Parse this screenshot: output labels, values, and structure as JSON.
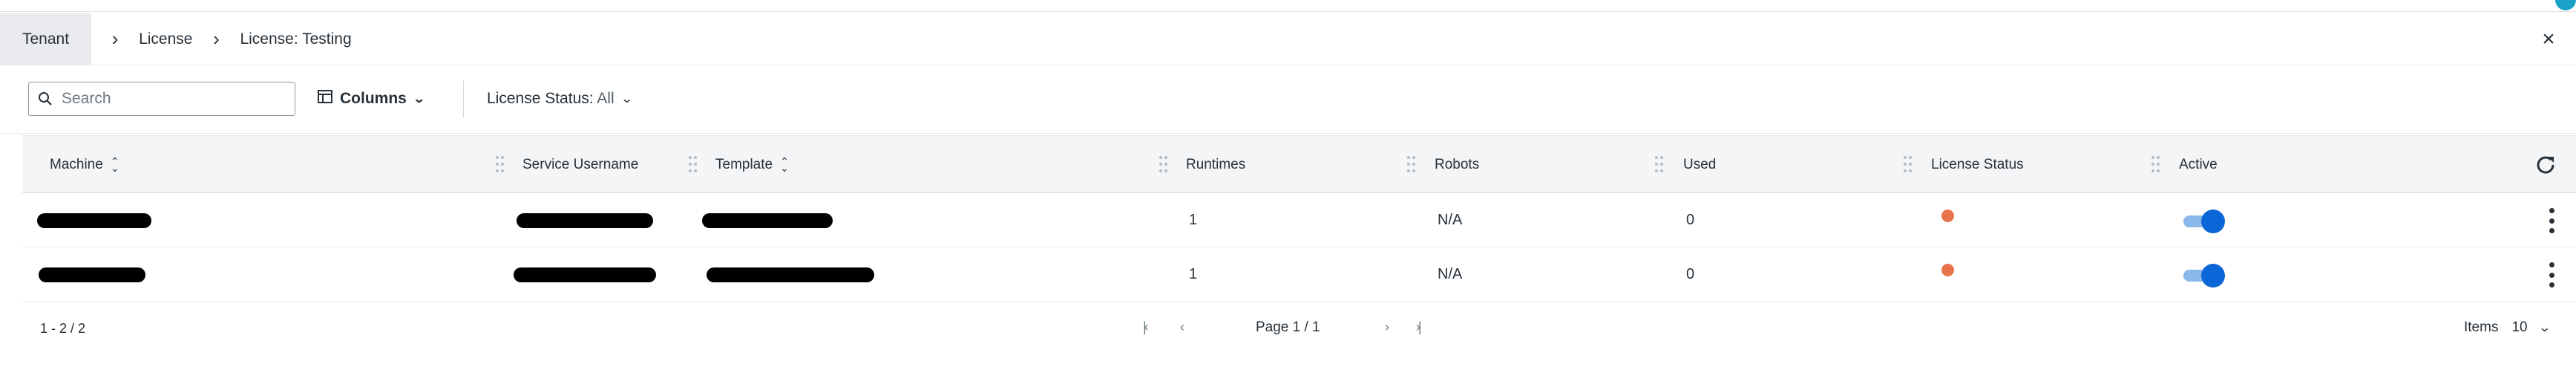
{
  "breadcrumb": {
    "items": [
      "Tenant",
      "License",
      "License: Testing"
    ],
    "separator": "›"
  },
  "toolbar": {
    "search_placeholder": "Search",
    "columns_label": "Columns",
    "status_filter_label": "License Status:",
    "status_filter_value": "All"
  },
  "table": {
    "columns": [
      "Machine",
      "Service Username",
      "Template",
      "Runtimes",
      "Robots",
      "Used",
      "License Status",
      "Active"
    ],
    "rows": [
      {
        "machine": "[redacted]",
        "service_username": "[redacted]",
        "template": "[redacted]",
        "runtimes": "1",
        "robots": "N/A",
        "used": "0",
        "license_status_color": "#e9744c",
        "active": true
      },
      {
        "machine": "[redacted]",
        "service_username": "[redacted]",
        "template": "[redacted]",
        "runtimes": "1",
        "robots": "N/A",
        "used": "0",
        "license_status_color": "#e9744c",
        "active": true
      }
    ]
  },
  "footer": {
    "range": "1 - 2 / 2",
    "page_label": "Page 1 / 1",
    "items_label": "Items",
    "items_value": "10"
  },
  "icons": {
    "close": "close-icon",
    "search": "search-icon",
    "columns": "columns-icon",
    "refresh": "refresh-icon",
    "sort": "sort-icon",
    "more": "kebab-menu-icon"
  },
  "colors": {
    "accent": "#0b67d8",
    "status_warning": "#e9744c",
    "header_bg": "#f4f5f7"
  }
}
